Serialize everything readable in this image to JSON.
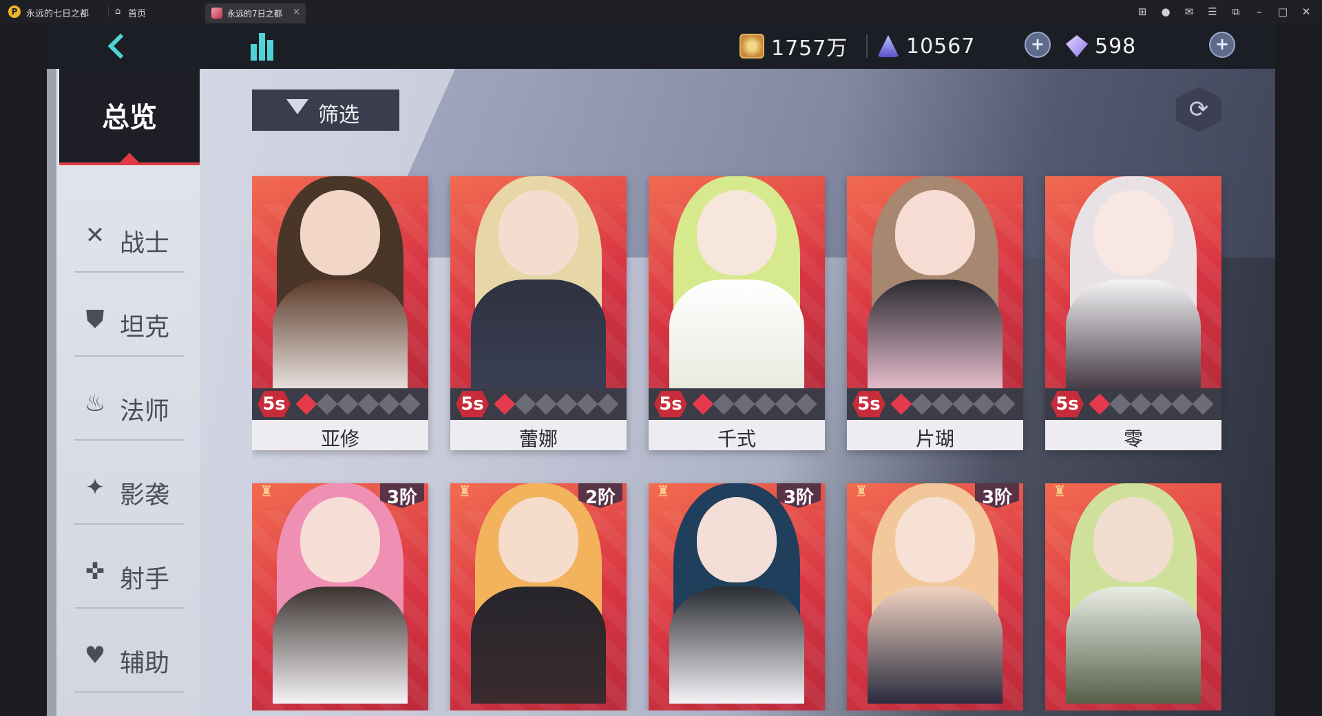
{
  "titlebar": {
    "app_name": "永远的七日之都",
    "home_tab": "首页",
    "game_tab": "永远的7日之都",
    "close_glyph": "×"
  },
  "resources": {
    "gold": "1757万",
    "stamina": "10567",
    "gems": "598"
  },
  "sidebar": {
    "overview": "总览",
    "categories": [
      {
        "label": "战士",
        "icon": "crossed-swords-icon",
        "glyph": "✕"
      },
      {
        "label": "坦克",
        "icon": "shield-icon",
        "glyph": "⛊"
      },
      {
        "label": "法师",
        "icon": "flame-icon",
        "glyph": "♨"
      },
      {
        "label": "影袭",
        "icon": "shuriken-icon",
        "glyph": "✦"
      },
      {
        "label": "射手",
        "icon": "crossbow-icon",
        "glyph": "✜"
      },
      {
        "label": "辅助",
        "icon": "heart-icon",
        "glyph": "♥"
      }
    ]
  },
  "filter": {
    "label": "筛选"
  },
  "cards": [
    {
      "name": "亚修",
      "grade": "5s",
      "stars_filled": 1,
      "stars_total": 6
    },
    {
      "name": "蕾娜",
      "grade": "5s",
      "stars_filled": 1,
      "stars_total": 6
    },
    {
      "name": "千式",
      "grade": "5s",
      "stars_filled": 1,
      "stars_total": 6
    },
    {
      "name": "片瑚",
      "grade": "5s",
      "stars_filled": 1,
      "stars_total": 6
    },
    {
      "name": "零",
      "grade": "5s",
      "stars_filled": 1,
      "stars_total": 6
    },
    {
      "rank": "3阶"
    },
    {
      "rank": "2阶"
    },
    {
      "rank": "3阶"
    },
    {
      "rank": "3阶"
    },
    {
      "rank": ""
    }
  ],
  "colors": {
    "accent": "#e23a45",
    "cyan": "#4fd3d6",
    "card_bg": "#d83542"
  }
}
